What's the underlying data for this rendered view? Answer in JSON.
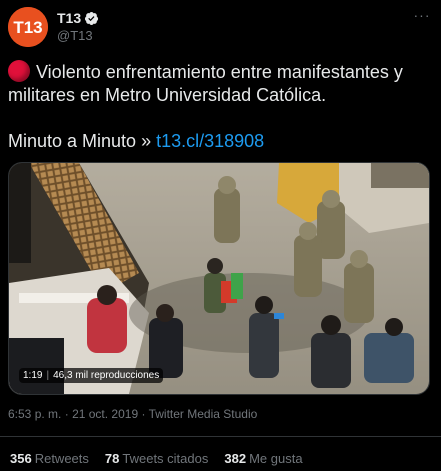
{
  "account": {
    "display_name": "T13",
    "handle": "@T13",
    "avatar_text": "T13",
    "brand_color": "#e8501f",
    "verified": true
  },
  "tweet": {
    "line1": "Violento enfrentamiento entre manifestantes y militares en Metro Universidad Católica.",
    "line2_prefix": "Minuto a Minuto »",
    "link_text": "t13.cl/318908"
  },
  "media": {
    "duration": "1:19",
    "views": "46,3 mil reproducciones"
  },
  "meta": {
    "time": "6:53 p. m.",
    "date": "21 oct. 2019",
    "source": "Twitter Media Studio",
    "separator": "·"
  },
  "stats": {
    "retweets_count": "356",
    "retweets_label": "Retweets",
    "quotes_count": "78",
    "quotes_label": "Tweets citados",
    "likes_count": "382",
    "likes_label": "Me gusta"
  },
  "colors": {
    "background": "#000000",
    "text": "#e7e9ea",
    "muted": "#71767b",
    "link": "#1d9bf0",
    "divider": "#2f3336",
    "alert": "#e0103a"
  },
  "icons": [
    "verified-badge-icon",
    "more-options-icon",
    "red-circle-emoji-icon"
  ]
}
